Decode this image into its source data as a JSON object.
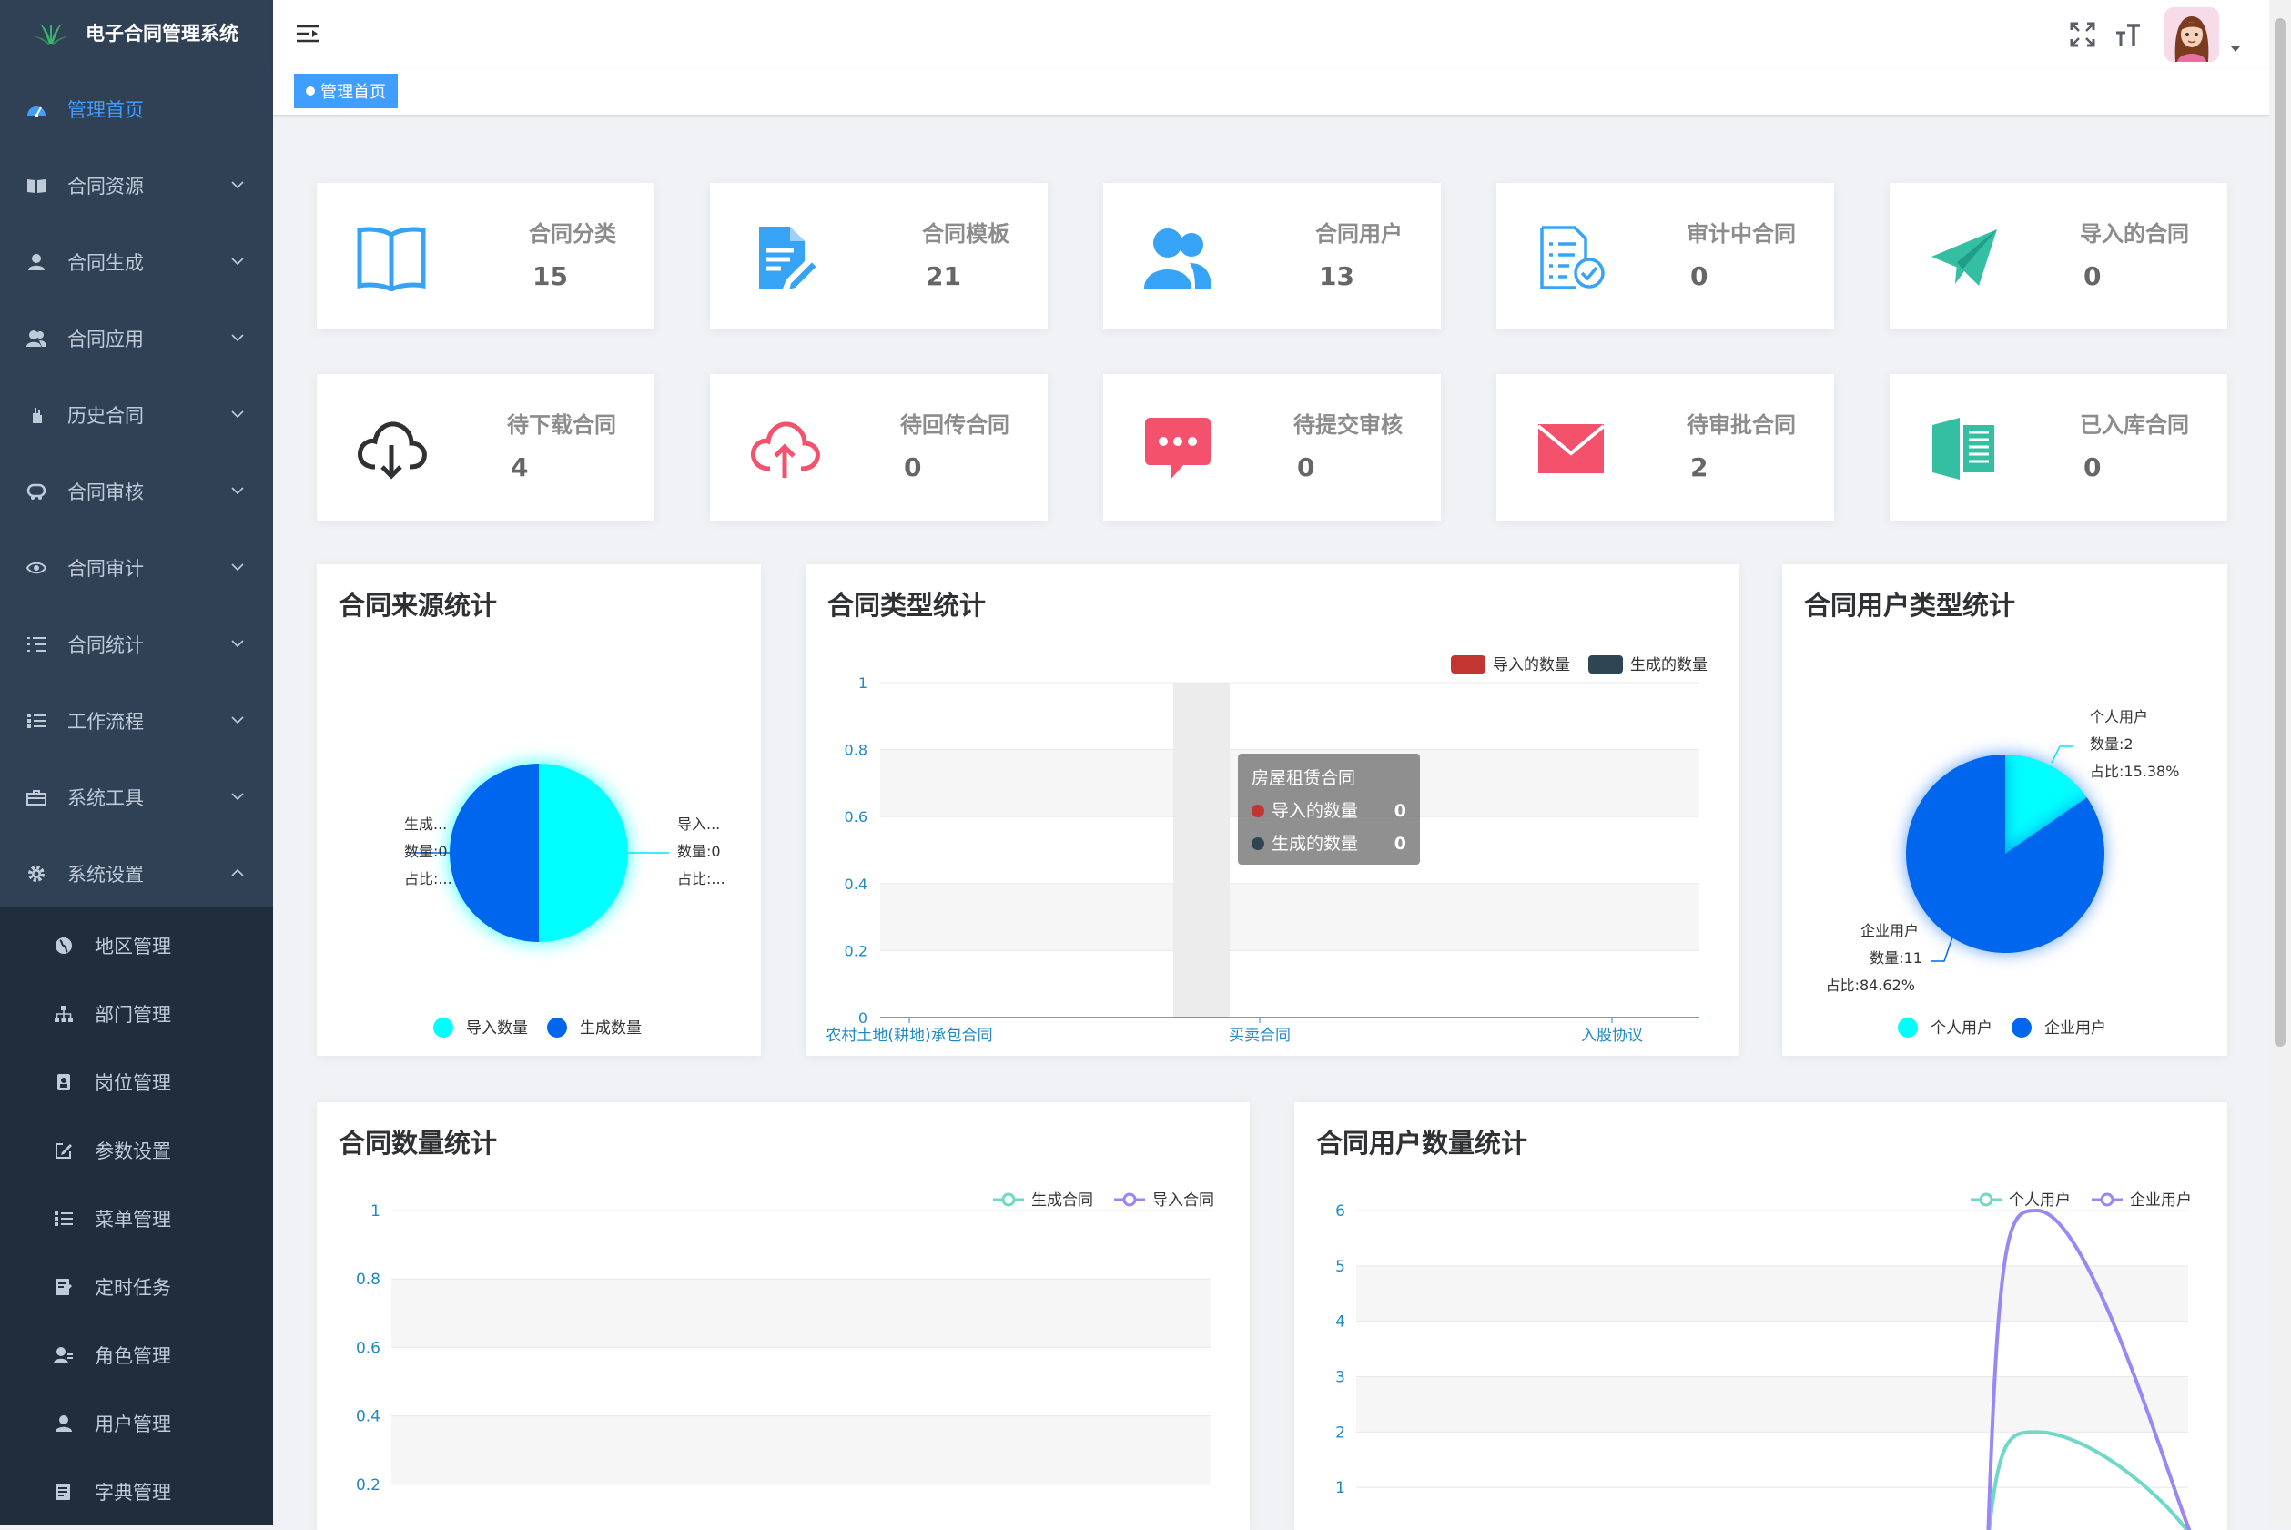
{
  "app": {
    "title": "电子合同管理系统"
  },
  "sidebar": {
    "items": [
      {
        "label": "管理首页",
        "icon": "dashboard-icon"
      },
      {
        "label": "合同资源",
        "icon": "book-icon"
      },
      {
        "label": "合同生成",
        "icon": "user-icon"
      },
      {
        "label": "合同应用",
        "icon": "users-icon"
      },
      {
        "label": "历史合同",
        "icon": "hand-icon"
      },
      {
        "label": "合同审核",
        "icon": "review-icon"
      },
      {
        "label": "合同审计",
        "icon": "eye-icon"
      },
      {
        "label": "合同统计",
        "icon": "list-icon"
      },
      {
        "label": "工作流程",
        "icon": "workflow-icon"
      },
      {
        "label": "系统工具",
        "icon": "toolbox-icon"
      },
      {
        "label": "系统设置",
        "icon": "gear-icon"
      }
    ],
    "subitems": [
      {
        "label": "地区管理",
        "icon": "globe-icon"
      },
      {
        "label": "部门管理",
        "icon": "tree-icon"
      },
      {
        "label": "岗位管理",
        "icon": "post-icon"
      },
      {
        "label": "参数设置",
        "icon": "edit-icon"
      },
      {
        "label": "菜单管理",
        "icon": "menu-list-icon"
      },
      {
        "label": "定时任务",
        "icon": "task-icon"
      },
      {
        "label": "角色管理",
        "icon": "role-icon"
      },
      {
        "label": "用户管理",
        "icon": "user-icon"
      },
      {
        "label": "字典管理",
        "icon": "dict-icon"
      }
    ]
  },
  "tags": {
    "active": "管理首页"
  },
  "stats": [
    {
      "label": "合同分类",
      "value": "15",
      "icon": "book-open-icon",
      "color": "#36a3f7"
    },
    {
      "label": "合同模板",
      "value": "21",
      "icon": "document-edit-icon",
      "color": "#36a3f7"
    },
    {
      "label": "合同用户",
      "value": "13",
      "icon": "users-icon",
      "color": "#36a3f7"
    },
    {
      "label": "审计中合同",
      "value": "0",
      "icon": "audit-doc-icon",
      "color": "#36a3f7"
    },
    {
      "label": "导入的合同",
      "value": "0",
      "icon": "paper-plane-icon",
      "color": "#34bfa3"
    },
    {
      "label": "待下载合同",
      "value": "4",
      "icon": "cloud-download-icon",
      "color": "#303133"
    },
    {
      "label": "待回传合同",
      "value": "0",
      "icon": "cloud-upload-icon",
      "color": "#f4516c"
    },
    {
      "label": "待提交审核",
      "value": "0",
      "icon": "chat-bubble-icon",
      "color": "#f4516c"
    },
    {
      "label": "待审批合同",
      "value": "2",
      "icon": "envelope-icon",
      "color": "#f4516c"
    },
    {
      "label": "已入库合同",
      "value": "0",
      "icon": "archive-book-icon",
      "color": "#34bfa3"
    }
  ],
  "panels": {
    "source": {
      "title": "合同来源统计"
    },
    "type": {
      "title": "合同类型统计"
    },
    "usertype": {
      "title": "合同用户类型统计"
    },
    "count": {
      "title": "合同数量统计"
    },
    "usercount": {
      "title": "合同用户数量统计"
    }
  },
  "chart_data": [
    {
      "type": "pie",
      "title": "合同来源统计",
      "slices": [
        {
          "name": "导入数量",
          "value": 0,
          "color": "#00ffff"
        },
        {
          "name": "生成数量",
          "value": 0,
          "color": "#0066ee"
        }
      ],
      "labels": [
        {
          "side": "left",
          "lines": [
            "生成...",
            "数量:0",
            "占比:..."
          ]
        },
        {
          "side": "right",
          "lines": [
            "导入...",
            "数量:0",
            "占比:..."
          ]
        }
      ],
      "legend": [
        "导入数量",
        "生成数量"
      ]
    },
    {
      "type": "bar",
      "title": "合同类型统计",
      "categories": [
        "农村土地(耕地)承包合同",
        "房屋租赁合同",
        "买卖合同",
        "入股协议"
      ],
      "tick_labels": [
        "农村土地(耕地)承包合同",
        "买卖合同",
        "入股协议"
      ],
      "series": [
        {
          "name": "导入的数量",
          "values": [
            0,
            0,
            0,
            0
          ],
          "color": "#c23531"
        },
        {
          "name": "生成的数量",
          "values": [
            0,
            0,
            0,
            0
          ],
          "color": "#2f4554"
        }
      ],
      "yticks": [
        "0",
        "0.2",
        "0.4",
        "0.6",
        "0.8",
        "1"
      ],
      "ylim": [
        0,
        1
      ],
      "tooltip": {
        "title": "房屋租赁合同",
        "rows": [
          {
            "name": "导入的数量",
            "value": "0"
          },
          {
            "name": "生成的数量",
            "value": "0"
          }
        ]
      }
    },
    {
      "type": "pie",
      "title": "合同用户类型统计",
      "slices": [
        {
          "name": "个人用户",
          "value": 2,
          "percent": "15.38%",
          "color": "#00ffff"
        },
        {
          "name": "企业用户",
          "value": 11,
          "percent": "84.62%",
          "color": "#0066ee"
        }
      ],
      "labels": [
        {
          "lines": [
            "个人用户",
            "数量:2",
            "占比:15.38%"
          ]
        },
        {
          "lines": [
            "企业用户",
            "数量:11",
            "占比:84.62%"
          ]
        }
      ],
      "legend": [
        "个人用户",
        "企业用户"
      ]
    },
    {
      "type": "line",
      "title": "合同数量统计",
      "series": [
        {
          "name": "生成合同",
          "color": "#6fd8c7"
        },
        {
          "name": "导入合同",
          "color": "#9b86f5"
        }
      ],
      "yticks": [
        "0.2",
        "0.4",
        "0.6",
        "0.8",
        "1"
      ],
      "ylim": [
        0,
        1
      ]
    },
    {
      "type": "line",
      "title": "合同用户数量统计",
      "series": [
        {
          "name": "个人用户",
          "color": "#6fd8c7",
          "values": [
            0,
            2,
            0
          ]
        },
        {
          "name": "企业用户",
          "color": "#9b86f5",
          "values": [
            0,
            6,
            0
          ]
        }
      ],
      "yticks": [
        "1",
        "2",
        "3",
        "4",
        "5",
        "6"
      ],
      "ylim": [
        0,
        6
      ]
    }
  ]
}
